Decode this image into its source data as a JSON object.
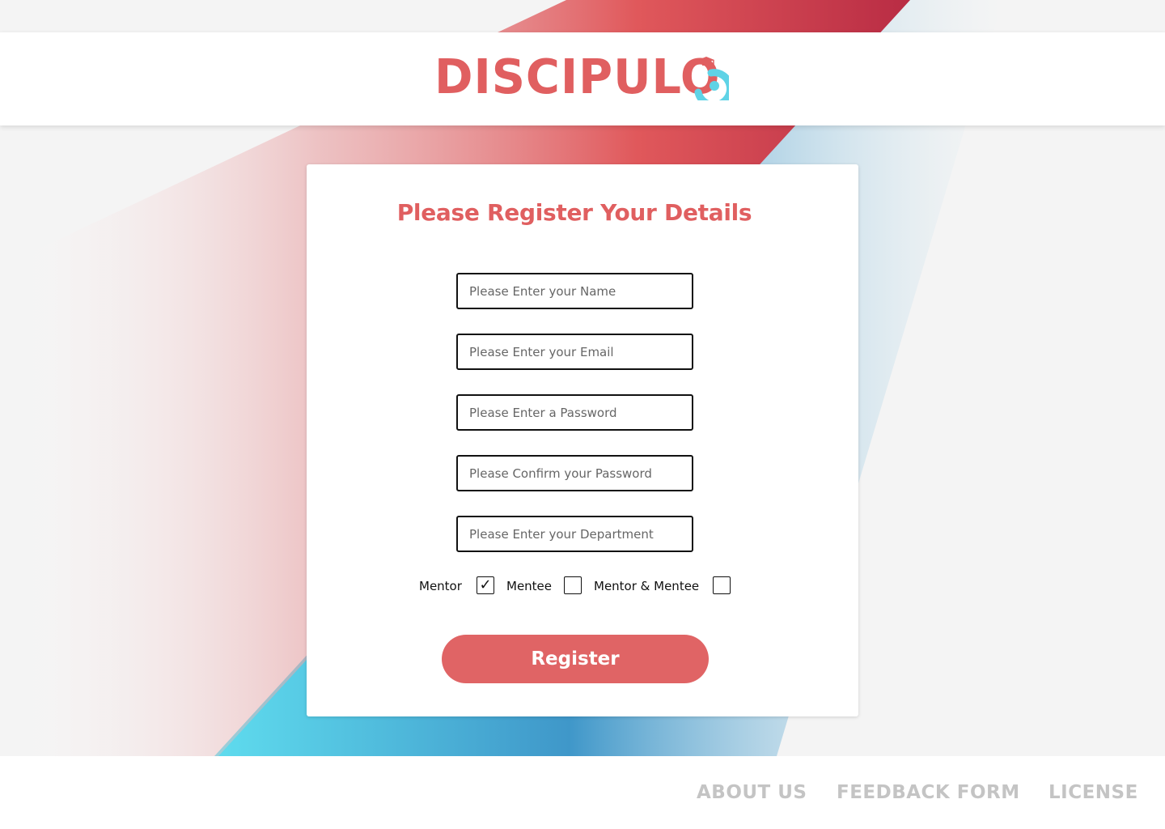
{
  "brand": {
    "name": "DISCIPULO",
    "color": "#e05f60",
    "accent": "#5fd3e6"
  },
  "form": {
    "title": "Please Register Your Details",
    "fields": [
      {
        "name": "name",
        "placeholder": "Please Enter your Name",
        "value": ""
      },
      {
        "name": "email",
        "placeholder": "Please Enter your Email",
        "value": ""
      },
      {
        "name": "password",
        "placeholder": "Please Enter a Password",
        "value": ""
      },
      {
        "name": "confirm-password",
        "placeholder": "Please Confirm your Password",
        "value": ""
      },
      {
        "name": "department",
        "placeholder": "Please Enter your Department",
        "value": ""
      }
    ],
    "roles": [
      {
        "label": "Mentor",
        "checked": true
      },
      {
        "label": "Mentee",
        "checked": false
      },
      {
        "label": "Mentor & Mentee",
        "checked": false
      }
    ],
    "check_glyph": "✓",
    "submit_label": "Register"
  },
  "footer": {
    "links": [
      "ABOUT US",
      "FEEDBACK FORM",
      "LICENSE"
    ]
  }
}
